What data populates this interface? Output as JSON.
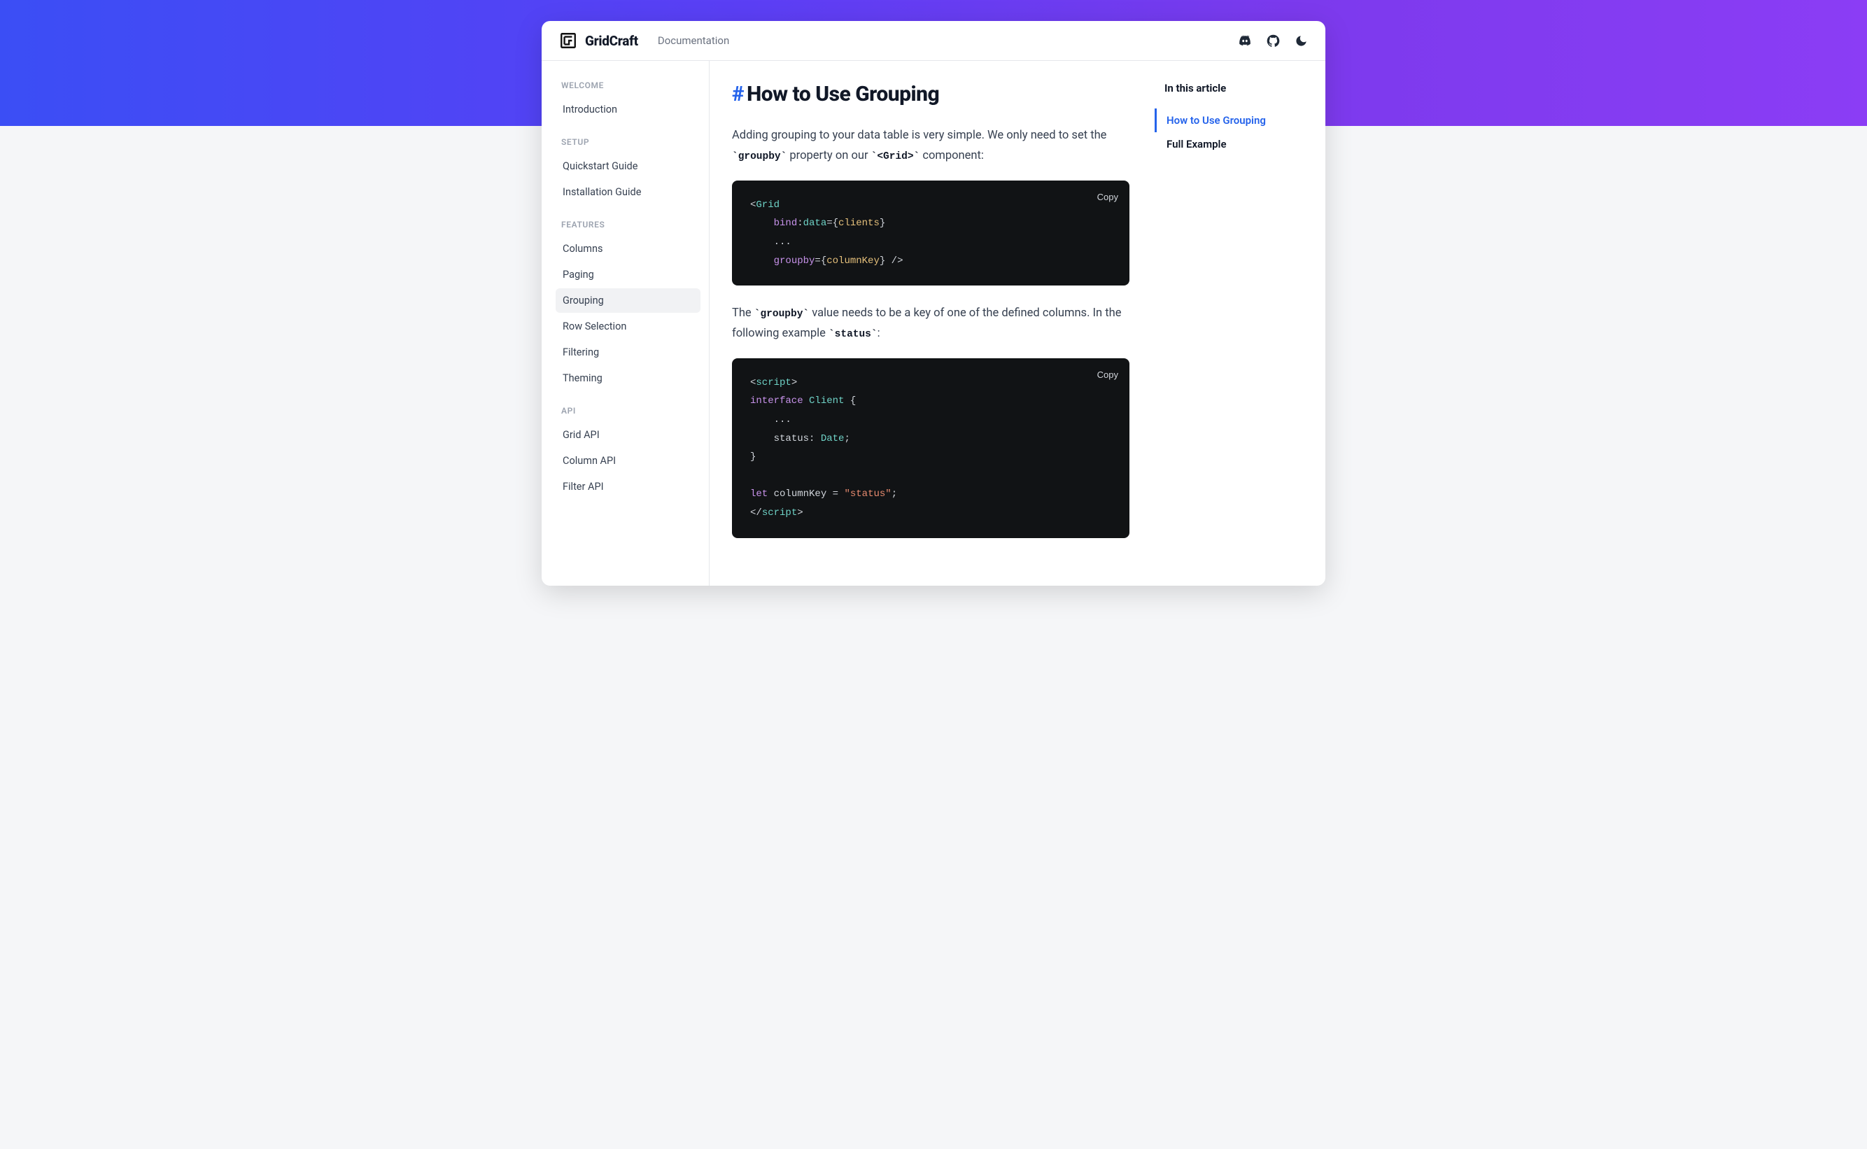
{
  "brand": {
    "name": "GridCraft"
  },
  "topnav": {
    "docs": "Documentation"
  },
  "sidebar": {
    "sections": [
      {
        "heading": "WELCOME",
        "items": [
          "Introduction"
        ]
      },
      {
        "heading": "SETUP",
        "items": [
          "Quickstart Guide",
          "Installation Guide"
        ]
      },
      {
        "heading": "FEATURES",
        "items": [
          "Columns",
          "Paging",
          "Grouping",
          "Row Selection",
          "Filtering",
          "Theming"
        ]
      },
      {
        "heading": "API",
        "items": [
          "Grid API",
          "Column API",
          "Filter API"
        ]
      }
    ],
    "active": "Grouping"
  },
  "article": {
    "title_hash": "#",
    "title": "How to Use Grouping",
    "p1_a": "Adding grouping to your data table is very simple. We only need to set the ",
    "p1_code1": "`groupby`",
    "p1_b": " property on our ",
    "p1_code2": "`<Grid>`",
    "p1_c": " component:",
    "p2_a": "The ",
    "p2_code1": "`groupby`",
    "p2_b": " value needs to be a key of one of the defined columns. In the following example ",
    "p2_code2": "`status`",
    "p2_c": ":",
    "copy_label": "Copy",
    "code1": {
      "l1": {
        "lt": "<",
        "tag": "Grid"
      },
      "l2": {
        "attr": "bind",
        "colon": ":",
        "attr2": "data",
        "eq": "=",
        "lb": "{",
        "val": "clients",
        "rb": "}"
      },
      "l3": {
        "dots": "..."
      },
      "l4": {
        "attr": "groupby",
        "eq": "=",
        "lb": "{",
        "val": "columnKey",
        "rb": "}",
        "close": " />"
      }
    },
    "code2": {
      "l1": {
        "lt": "<",
        "tag": "script",
        "gt": ">"
      },
      "l2": {
        "kw": "interface",
        "type": "Client",
        "lb": " {"
      },
      "l3": {
        "dots": "..."
      },
      "l4": {
        "prop": "status",
        "colon": ": ",
        "type": "Date",
        "semi": ";"
      },
      "l5": {
        "rb": "}"
      },
      "l6": {
        "blank": " "
      },
      "l7": {
        "kw": "let",
        "name": "columnKey",
        "eq": " = ",
        "str": "\"status\"",
        "semi": ";"
      },
      "l8": {
        "lt": "</",
        "tag": "script",
        "gt": ">"
      }
    }
  },
  "toc": {
    "heading": "In this article",
    "items": [
      "How to Use Grouping",
      "Full Example"
    ],
    "active": "How to Use Grouping"
  }
}
